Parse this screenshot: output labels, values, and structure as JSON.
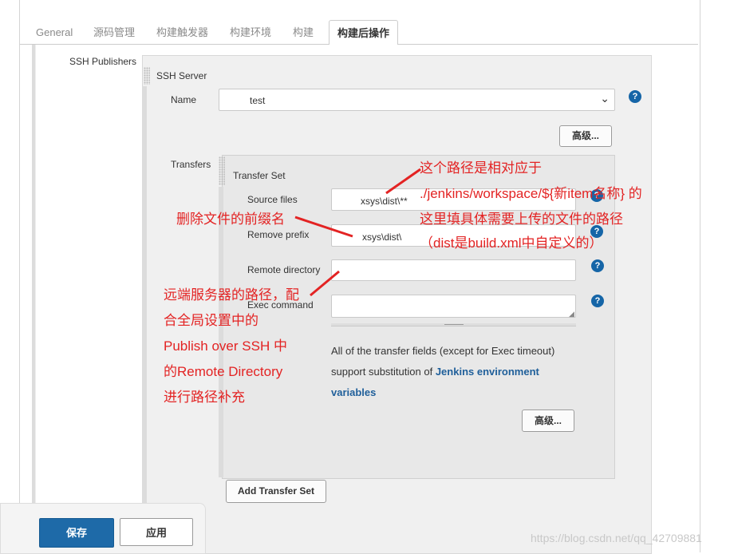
{
  "tabs": [
    {
      "label": "General"
    },
    {
      "label": "源码管理"
    },
    {
      "label": "构建触发器"
    },
    {
      "label": "构建环境"
    },
    {
      "label": "构建"
    },
    {
      "label": "构建后操作"
    }
  ],
  "ssh_publishers": {
    "section_label": "SSH Publishers",
    "server_title": "SSH Server",
    "name_label": "Name",
    "name_value": "test",
    "advanced_label": "高级..."
  },
  "transfers": {
    "label": "Transfers",
    "set_title": "Transfer Set",
    "source_files_label": "Source files",
    "source_files_value": "xsys\\dist\\**",
    "remove_prefix_label": "Remove prefix",
    "remove_prefix_value": "xsys\\dist\\",
    "remote_directory_label": "Remote directory",
    "remote_directory_value": "",
    "exec_command_label": "Exec command",
    "exec_command_value": "",
    "note_text": "All of the transfer fields (except for Exec timeout) support substitution of",
    "note_link": "Jenkins environment variables",
    "advanced_label": "高级...",
    "add_button": "Add Transfer Set"
  },
  "annotations": {
    "source_line1": "这个路径是相对应于",
    "source_line2": "./jenkins/workspace/${新item名称} 的",
    "source_line3": "这里填具体需要上传的文件的路径",
    "source_line4": "（dist是build.xml中自定义的）",
    "prefix": "删除文件的前缀名",
    "remote_line1": "远端服务器的路径，配",
    "remote_line2": "合全局设置中的",
    "remote_line3": "Publish over SSH 中",
    "remote_line4": "的Remote Directory",
    "remote_line5": "进行路径补充"
  },
  "actions": {
    "save": "保存",
    "apply": "应用"
  },
  "watermark": "https://blog.csdn.net/qq_42709881",
  "colors": {
    "annotation_red": "#e32323",
    "primary_blue": "#1e6aa8",
    "help_blue": "#1565a7"
  }
}
